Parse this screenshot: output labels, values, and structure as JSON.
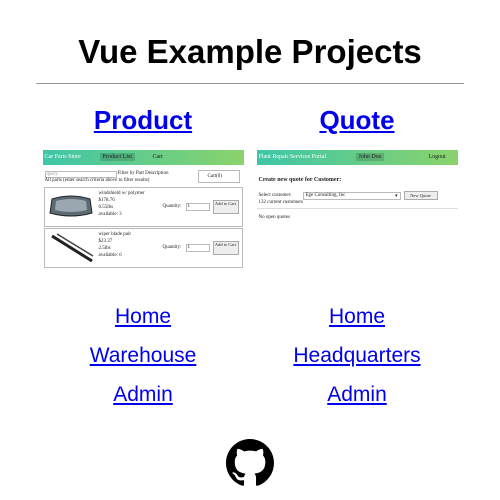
{
  "page": {
    "title": "Vue Example Projects"
  },
  "product": {
    "heading": "Product",
    "preview": {
      "nav": [
        "Car Parts Store",
        "Product List",
        "Cart"
      ],
      "search_placeholder": "query",
      "filter_label": "Filter by Part Description",
      "cart_label": "Cart(0)",
      "hint": "All parts (enter search criteria above to filter results)",
      "items": [
        {
          "name": "windshield w/ polymer",
          "price": "$178.76",
          "weight": "0.55lbs",
          "available": "available: 3",
          "quantity_label": "Quantity:",
          "quantity": "1",
          "button": "Add to Cart"
        },
        {
          "name": "wiper blade pair",
          "price": "$23.37",
          "weight": "2.5lbs",
          "available": "available: 6",
          "quantity_label": "Quantity:",
          "quantity": "1",
          "button": "Add to Cart"
        }
      ]
    },
    "links": [
      "Home",
      "Warehouse",
      "Admin"
    ]
  },
  "quote": {
    "heading": "Quote",
    "preview": {
      "nav": [
        "Plant Repair Services Portal",
        "John Doe",
        "Logout"
      ],
      "heading": "Create new quote for Customer:",
      "select_label": "Select customer:",
      "select_value": "Ege Consulting, Inc",
      "new_button": "New Quote",
      "count": "132 current customers",
      "empty": "No open quotes"
    },
    "links": [
      "Home",
      "Headquarters",
      "Admin"
    ]
  },
  "footer": {
    "icon": "github-icon"
  }
}
